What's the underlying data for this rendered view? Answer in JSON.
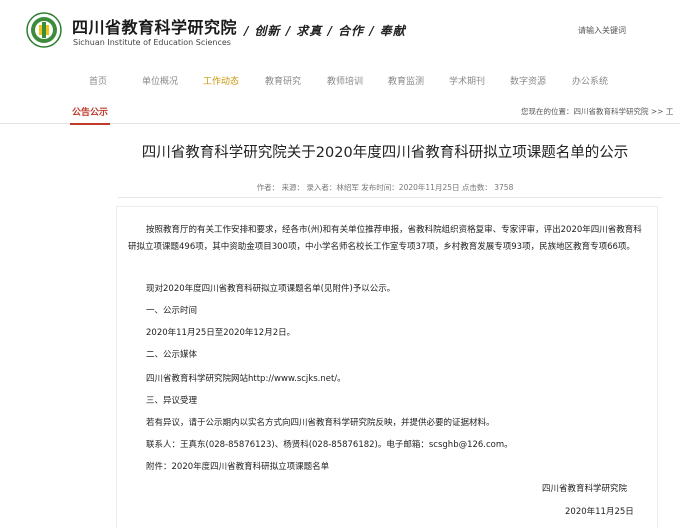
{
  "header": {
    "org_name_cn": "四川省教育科学研究院",
    "org_name_en": "Sichuan Institute of Education Sciences",
    "motto": "/ 创新 / 求真 / 合作 / 奉献",
    "search_hint": "请输入关键词"
  },
  "nav": [
    {
      "label": "首页",
      "active": false
    },
    {
      "label": "单位概况",
      "active": false
    },
    {
      "label": "工作动态",
      "active": true
    },
    {
      "label": "教育研究",
      "active": false
    },
    {
      "label": "教师培训",
      "active": false
    },
    {
      "label": "教育监测",
      "active": false
    },
    {
      "label": "学术期刊",
      "active": false
    },
    {
      "label": "数字资源",
      "active": false
    },
    {
      "label": "办公系统",
      "active": false
    }
  ],
  "section": {
    "title": "公告公示",
    "breadcrumb": "您现在的位置：四川省教育科学研究院 >> 工"
  },
  "article": {
    "title": "四川省教育科学研究院关于2020年度四川省教育科研拟立项课题名单的公示",
    "meta": "作者：  来源：  录入者：林绍军  发布时间：2020年11月25日  点击数：  3758",
    "intro": "按照教育厅的有关工作安排和要求，经各市(州)和有关单位推荐申报，省教科院组织资格复审、专家评审，评出2020年四川省教育科研拟立项课题496项，其中资助金项目300项，中小学名师名校长工作室专项37项，乡村教育发展专项93项，民族地区教育专项66项。",
    "notice": "现对2020年度四川省教育科研拟立项课题名单(见附件)予以公示。",
    "h1": "一、公示时间",
    "period": "2020年11月25日至2020年12月2日。",
    "h2": "二、公示媒体",
    "media": "四川省教育科学研究院网站http://www.scjks.net/。",
    "h3": "三、异议受理",
    "objection": "若有异议，请于公示期内以实名方式向四川省教育科学研究院反映，并提供必要的证据材料。",
    "contact": "联系人：王真东(028-85876123)、杨贤科(028-85876182)。电子邮箱：scsghb@126.com。",
    "attachment": "附件：2020年度四川省教育科研拟立项课题名单",
    "signature": "四川省教育科学研究院",
    "date": "2020年11月25日"
  }
}
